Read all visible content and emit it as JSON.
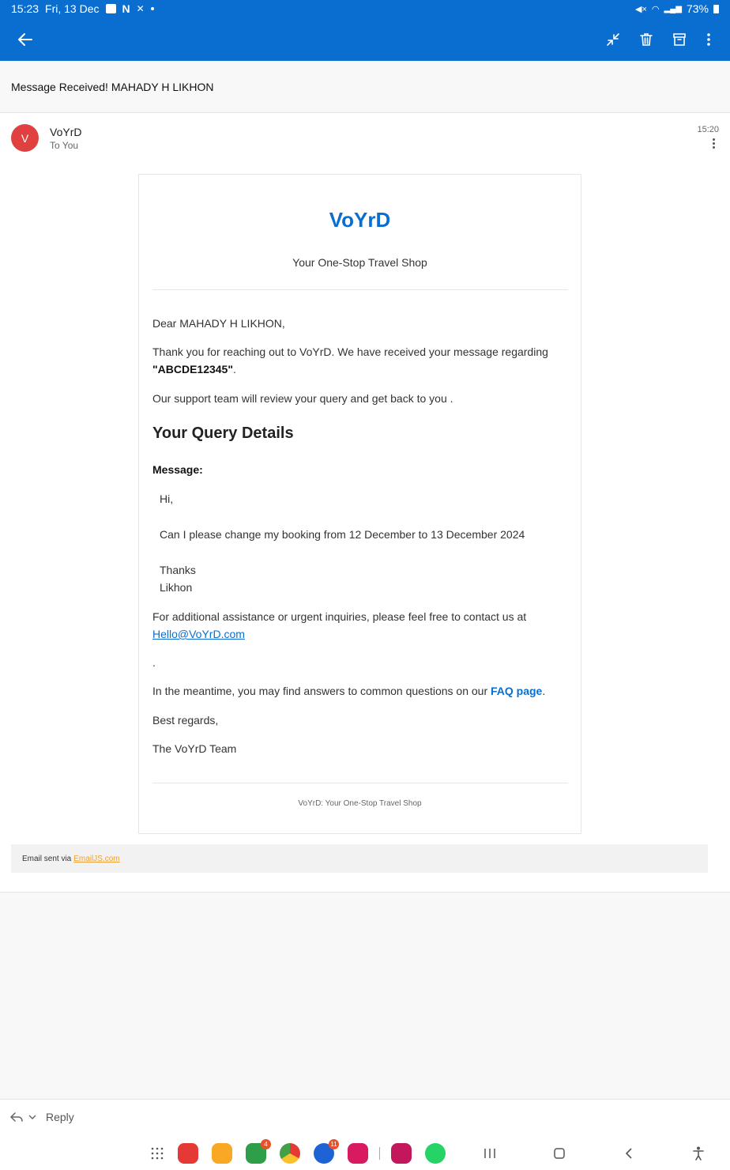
{
  "status_bar": {
    "time": "15:23",
    "date": "Fri, 13 Dec",
    "battery": "73%"
  },
  "toolbar": {
    "back_icon": "arrow-left-icon",
    "collapse_icon": "collapse-icon",
    "delete_icon": "trash-icon",
    "archive_icon": "archive-icon",
    "more_icon": "more-vertical-icon"
  },
  "email": {
    "subject": "Message Received! MAHADY H LIKHON",
    "sender": {
      "initial": "V",
      "name": "VoYrD",
      "to": "To You",
      "time": "15:20"
    },
    "body": {
      "brand": "VoYrD",
      "tagline": "Your One-Stop Travel Shop",
      "greeting": "Dear MAHADY H LIKHON,",
      "thanks_line": "Thank you for reaching out to VoYrD. We have received your message regarding",
      "reference": "\"ABCDE12345\"",
      "reference_end": ".",
      "review_line": "Our support team will review your query and get back to you .",
      "details_heading": "Your Query Details",
      "message_label": "Message:",
      "message_lines": [
        "Hi,",
        "Can I please change my booking from 12 December to 13 December 2024",
        "Thanks",
        "Likhon"
      ],
      "assistance_line": "For additional assistance or urgent inquiries, please feel free to contact us at",
      "contact_email": "Hello@VoYrD.com",
      "dot_line": ".",
      "faq_prefix": "In the meantime, you may find answers to common questions on our",
      "faq_link": "FAQ page",
      "faq_suffix": ".",
      "regards": "Best regards,",
      "signature": "The VoYrD Team",
      "footer": "VoYrD: Your One-Stop Travel Shop"
    },
    "sent_via_prefix": "Email sent via",
    "sent_via_link": "EmailJS.com"
  },
  "reply_bar": {
    "reply_label": "Reply"
  },
  "dock": {
    "badges": {
      "phone": "4",
      "messages": "11"
    }
  },
  "colors": {
    "accent": "#0a6ed1",
    "avatar": "#e04040",
    "emailjs_link": "#f0a030"
  }
}
